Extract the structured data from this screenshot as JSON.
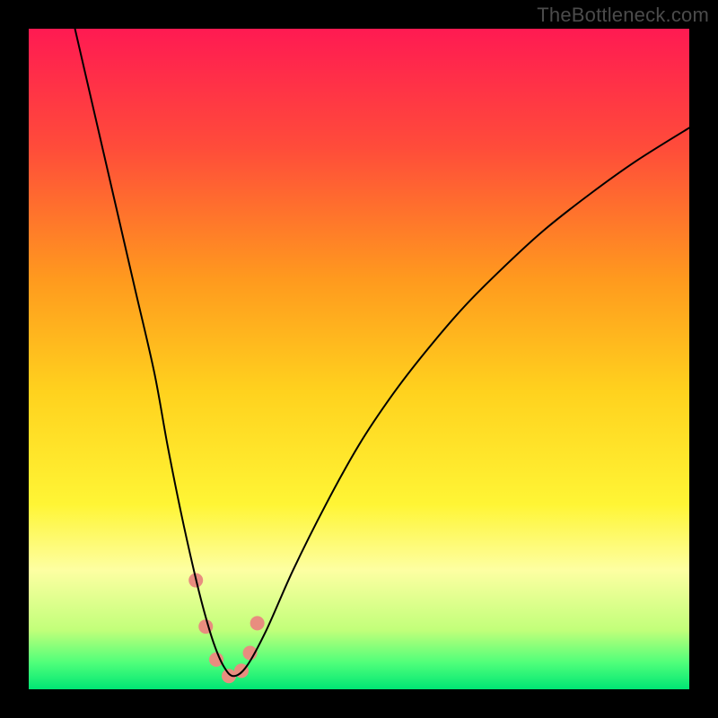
{
  "watermark": "TheBottleneck.com",
  "chart_data": {
    "type": "line",
    "title": "",
    "xlabel": "",
    "ylabel": "",
    "xlim": [
      0,
      100
    ],
    "ylim": [
      0,
      100
    ],
    "background_gradient": {
      "stops": [
        {
          "pct": 0,
          "color": "#ff1a52"
        },
        {
          "pct": 18,
          "color": "#ff4c3a"
        },
        {
          "pct": 38,
          "color": "#ff9a1e"
        },
        {
          "pct": 55,
          "color": "#ffd21e"
        },
        {
          "pct": 72,
          "color": "#fff535"
        },
        {
          "pct": 82,
          "color": "#fdffa2"
        },
        {
          "pct": 91,
          "color": "#c2ff7a"
        },
        {
          "pct": 96,
          "color": "#4fff7a"
        },
        {
          "pct": 100,
          "color": "#00e574"
        }
      ]
    },
    "series": [
      {
        "name": "bottleneck-curve",
        "color": "#000000",
        "stroke_width": 2,
        "x": [
          7,
          10,
          13,
          16,
          19,
          21,
          23,
          25,
          26.5,
          28,
          29.5,
          31,
          33,
          36,
          40,
          45,
          50,
          55,
          60,
          66,
          72,
          78,
          85,
          92,
          100
        ],
        "values": [
          100,
          87,
          74,
          61,
          48,
          37,
          27,
          18,
          12,
          7,
          3.5,
          2,
          3.5,
          9,
          18,
          28,
          37,
          44.5,
          51,
          58,
          64,
          69.5,
          75,
          80,
          85
        ]
      }
    ],
    "markers": {
      "name": "highlight-region",
      "color": "#e88d7f",
      "pixel_radius": 8,
      "points": [
        {
          "x": 25.3,
          "y": 16.5
        },
        {
          "x": 26.8,
          "y": 9.5
        },
        {
          "x": 28.4,
          "y": 4.5
        },
        {
          "x": 30.3,
          "y": 2.0
        },
        {
          "x": 32.2,
          "y": 2.8
        },
        {
          "x": 33.5,
          "y": 5.5
        },
        {
          "x": 34.6,
          "y": 10.0
        }
      ]
    }
  }
}
